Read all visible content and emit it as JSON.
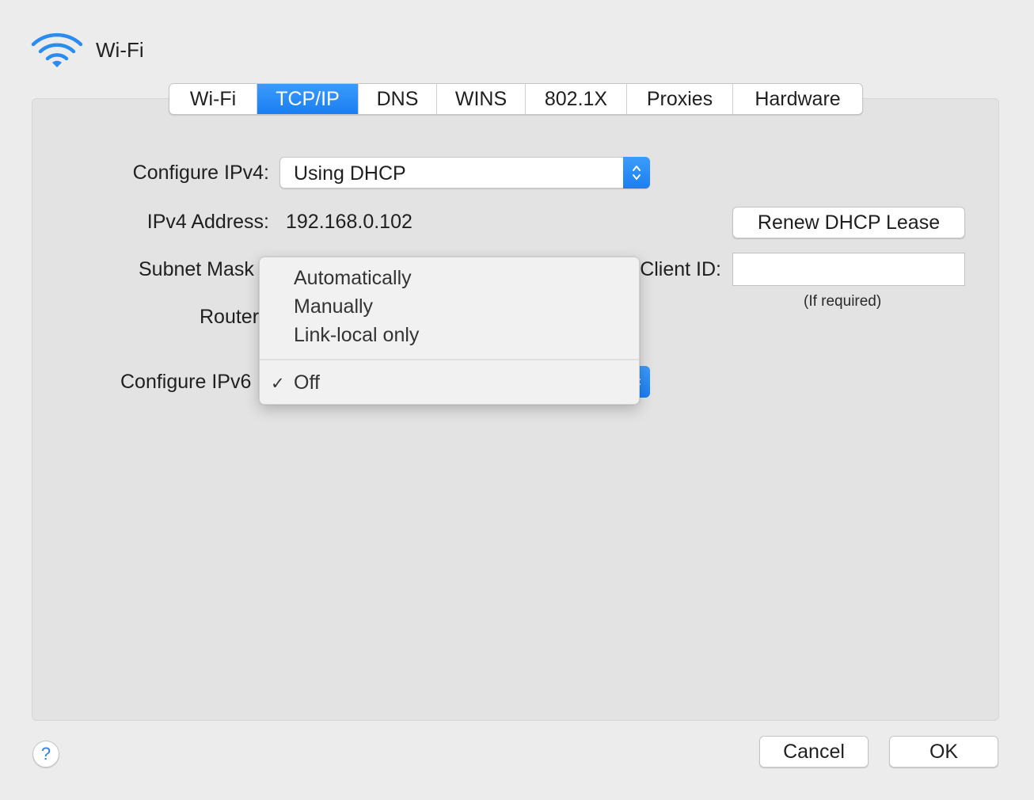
{
  "window": {
    "title": "Wi-Fi",
    "icon": "wifi-icon"
  },
  "tabs": [
    {
      "label": "Wi-Fi",
      "active": false
    },
    {
      "label": "TCP/IP",
      "active": true
    },
    {
      "label": "DNS",
      "active": false
    },
    {
      "label": "WINS",
      "active": false
    },
    {
      "label": "802.1X",
      "active": false
    },
    {
      "label": "Proxies",
      "active": false
    },
    {
      "label": "Hardware",
      "active": false
    }
  ],
  "form": {
    "configure_ipv4_label": "Configure IPv4:",
    "configure_ipv4_value": "Using DHCP",
    "ipv4_address_label": "IPv4 Address:",
    "ipv4_address_value": "192.168.0.102",
    "subnet_mask_label": "Subnet Mask",
    "router_label": "Router",
    "configure_ipv6_label": "Configure IPv6",
    "renew_button": "Renew DHCP Lease",
    "client_id_label": "Client ID:",
    "client_id_value": "",
    "client_id_hint": "(If required)"
  },
  "ipv6_menu": {
    "items": [
      "Automatically",
      "Manually",
      "Link-local only"
    ],
    "selected": "Off",
    "check_glyph": "✓"
  },
  "footer": {
    "help": "?",
    "cancel": "Cancel",
    "ok": "OK"
  },
  "colors": {
    "accent": "#1a7ef2",
    "background": "#ececec",
    "panel": "#e3e3e3"
  }
}
